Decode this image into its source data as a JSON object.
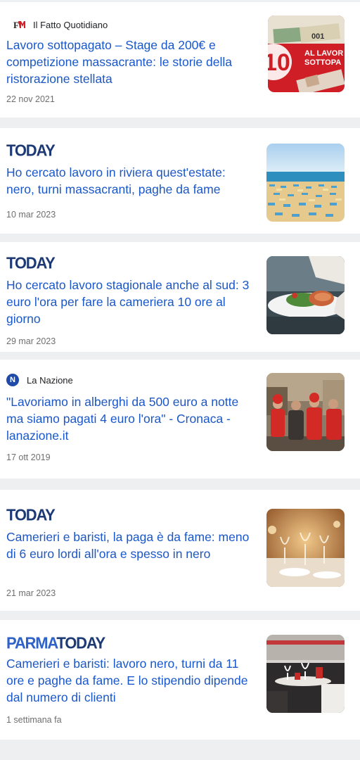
{
  "articles": [
    {
      "source": "Il Fatto Quotidiano",
      "title": "Lavoro sottopagato – Stage da 200€ e competizione massacrante: le storie della ristorazione stellata",
      "date": "22 nov 2021",
      "thumb_text_1": "AL LAVOR",
      "thumb_text_2": "SOTTOPA",
      "thumb_note": "001"
    },
    {
      "source": "TODAY",
      "title": "Ho cercato lavoro in riviera quest'estate: nero, turni massacranti, paghe da fame",
      "date": "10 mar 2023"
    },
    {
      "source": "TODAY",
      "title": "Ho cercato lavoro stagionale anche al sud: 3 euro l'ora per fare la cameriera 10 ore al giorno",
      "date": "29 mar 2023"
    },
    {
      "source": "La Nazione",
      "source_logo_letter": "N",
      "title": "\"Lavoriamo in alberghi da 500 euro a notte ma siamo pagati 4 euro l'ora\" - Cronaca - lanazione.it",
      "date": "17 ott 2019"
    },
    {
      "source": "TODAY",
      "title": "Camerieri e baristi, la paga è da fame: meno di 6 euro lordi all'ora e spesso in nero",
      "date": "21 mar 2023"
    },
    {
      "source_part_1": "PARMA",
      "source_part_2": "TODAY",
      "title": "Camerieri e baristi: lavoro nero, turni da 11 ore e paghe da fame. E lo stipendio dipende dal numero di clienti",
      "date": "1 settimana fa"
    }
  ],
  "colors": {
    "title_blue": "#1a57c9",
    "today_navy": "#1d3a74",
    "parma_blue": "#2e62c9",
    "la_nazione_blue": "#1f4aa8",
    "date_gray": "#6f6f6f",
    "separator_gray": "#eeeff1"
  }
}
